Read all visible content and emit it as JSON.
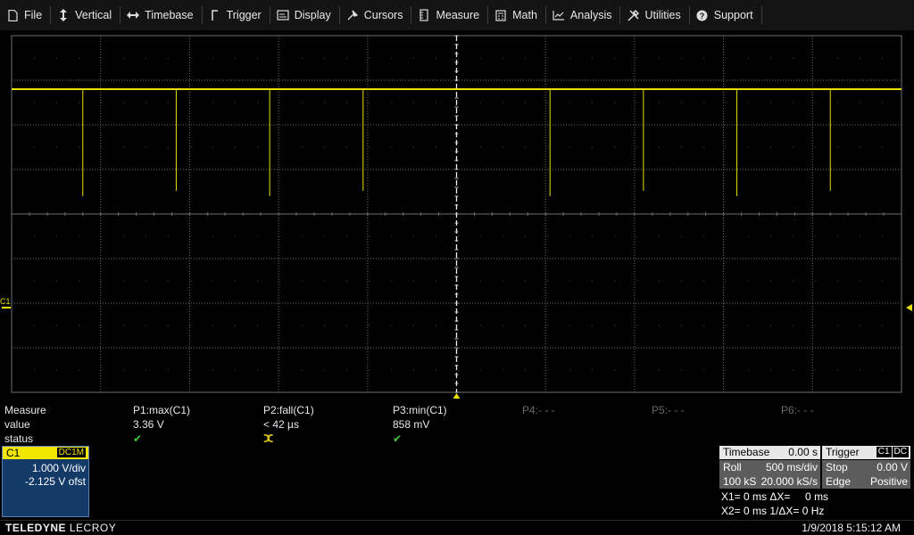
{
  "menu": [
    {
      "label": "File",
      "icon": "file-icon"
    },
    {
      "label": "Vertical",
      "icon": "vertical-arrows-icon"
    },
    {
      "label": "Timebase",
      "icon": "horizontal-arrows-icon"
    },
    {
      "label": "Trigger",
      "icon": "trigger-icon"
    },
    {
      "label": "Display",
      "icon": "display-icon"
    },
    {
      "label": "Cursors",
      "icon": "cursor-icon"
    },
    {
      "label": "Measure",
      "icon": "measure-icon"
    },
    {
      "label": "Math",
      "icon": "math-icon"
    },
    {
      "label": "Analysis",
      "icon": "analysis-icon"
    },
    {
      "label": "Utilities",
      "icon": "utilities-icon"
    },
    {
      "label": "Support",
      "icon": "support-icon"
    }
  ],
  "channel_marker": "C1",
  "colors": {
    "trace": "#e8e000",
    "grid": "#6e6e6e",
    "check": "#45c840",
    "channel_bg": "#143a68"
  },
  "measure": {
    "headers": [
      "Measure",
      "P1:max(C1)",
      "P2:fall(C1)",
      "P3:min(C1)",
      "P4:- - -",
      "P5:- - -",
      "P6:- - -"
    ],
    "value_label": "value",
    "values": [
      "3.36 V",
      "< 42 µs",
      "858 mV"
    ],
    "status_label": "status",
    "status": [
      "ok",
      "warning",
      "ok"
    ]
  },
  "channel": {
    "name": "C1",
    "coupling": "DC1M",
    "vdiv": "1.000 V/div",
    "offset": "-2.125 V ofst"
  },
  "timebase": {
    "title": "Timebase",
    "delay": "0.00 s",
    "mode": "Roll",
    "tdiv": "500 ms/div",
    "samples": "100 kS",
    "rate": "20.000 kS/s"
  },
  "trigger": {
    "title": "Trigger",
    "source": "C1",
    "coupling": "DC",
    "mode": "Stop",
    "level": "0.00 V",
    "type": "Edge",
    "slope": "Positive"
  },
  "cursors": {
    "x1": "X1= 0 ms ΔX=     0 ms",
    "x2": "X2= 0 ms 1/ΔX= 0 Hz"
  },
  "brand": {
    "a": "TELEDYNE",
    "b": "LECROY"
  },
  "timestamp": "1/9/2018 5:15:12 AM",
  "waveform": {
    "high_level_div": 1.2,
    "glitch_positions_div": [
      0.8,
      1.85,
      2.9,
      3.95,
      6.05,
      7.1,
      8.15,
      9.2
    ],
    "glitch_depth_div": 2.4
  }
}
